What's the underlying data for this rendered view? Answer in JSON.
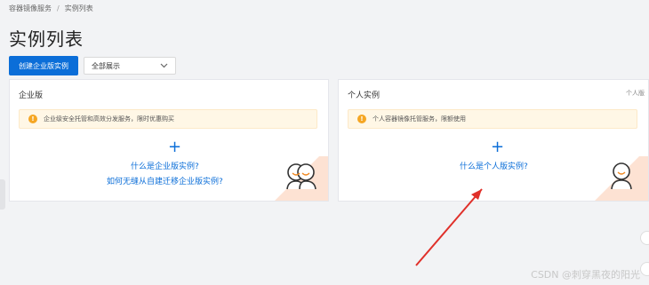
{
  "breadcrumb": {
    "root": "容器镜像服务",
    "separator": "/",
    "current": "实例列表"
  },
  "page": {
    "title": "实例列表"
  },
  "toolbar": {
    "create_button": "创建企业版实例",
    "filter_value": "全部展示"
  },
  "cards": {
    "enterprise": {
      "title": "企业版",
      "notice": "企业级安全托管和高效分发服务，限时优惠购买",
      "plus": "+",
      "link_what": "什么是企业版实例?",
      "link_migrate": "如何无缝从自建迁移企业版实例?"
    },
    "personal": {
      "title": "个人实例",
      "tag": "个人版",
      "notice": "个人容器镜像托管服务，限额使用",
      "plus": "+",
      "link_what": "什么是个人版实例?"
    }
  },
  "watermark": "CSDN @刺穿黑夜的阳光",
  "colors": {
    "primary": "#0b6ed8",
    "notice_bg": "#fff7e6",
    "warning": "#f5a623",
    "annotation_arrow": "#e0302a"
  },
  "icons": {
    "warning": "warning-icon",
    "plus": "plus-icon",
    "dropdown": "chevron-down-icon"
  }
}
